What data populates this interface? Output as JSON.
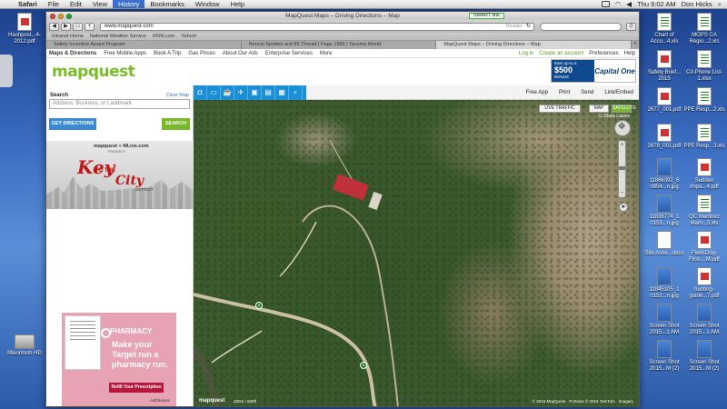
{
  "menubar": {
    "items": [
      "Safari",
      "File",
      "Edit",
      "View",
      "History",
      "Bookmarks",
      "Window",
      "Help"
    ],
    "clock": "Thu 9:02 AM",
    "user": "Don Hicks"
  },
  "window": {
    "title": "MapQuest Maps – Driving Directions – Map",
    "smart_link": "SMART link",
    "url": "www.mapquest.com",
    "reader": "Reader"
  },
  "bookmarks": [
    "Intranet Home",
    "National Weather Service",
    "MSN.com",
    "Yahoo!"
  ],
  "tabs": [
    "Safety Incentive Award Program",
    "Noncal Spotted and 85 Thread | Page 1965 | Tacoma World",
    "MapQuest Maps – Driving Directions – Map"
  ],
  "mq": {
    "topnav": [
      "Maps & Directions",
      "Free Mobile Apps",
      "Book A Trip",
      "Gas Prices",
      "About Our Ads",
      "Enterprise Services",
      "More"
    ],
    "login": "Log in",
    "create_account": "Create an account",
    "preferences": "Preferences",
    "help": "Help",
    "logo": "mapquest",
    "ad": {
      "line1": "Earn up to a",
      "amount": "$500",
      "bonus": "BONUS",
      "brand": "Capital One"
    },
    "search_label": "Search",
    "clear_map": "Clear Map",
    "search_placeholder": "Address, Business, or Landmark",
    "get_directions": "GET DIRECTIONS",
    "search_button": "SEARCH",
    "promo": {
      "brand": "mapquest + MLive.com",
      "presents": "PRESENTS",
      "key": "Key",
      "to_the": "TO THE",
      "city": "City",
      "detroit": "DETROIT"
    },
    "pharmacy": {
      "title": "PHARMACY",
      "body": "Make your Target run a pharmacy run.",
      "cta": "Refill Your Prescription"
    },
    "adchoices": "AdChoices",
    "map_toolbar_icons": [
      "mq-icon",
      "hotel-icon",
      "food-icon",
      "plane-icon",
      "car-icon",
      "cart-icon",
      "bus-icon",
      "search-icon"
    ],
    "map_actions": [
      "Free App",
      "Print",
      "Send",
      "Link/Embed"
    ],
    "live_traffic": "LIVE TRAFFIC",
    "map_types": [
      "MAP",
      "SATELLITE"
    ],
    "active_map_type": "SATELLITE",
    "show_labels": "Show Labels",
    "watermark": "mapquest",
    "scale": "200m / 600ft",
    "copyright": "© 2015 MapQuest · Portions © 2015 TomTom · Imagery"
  },
  "desktop_icons": [
    {
      "label": "Hashpost...4-2012.pdf",
      "type": "pdf"
    },
    {
      "label": "Chart of Acco...4.xls",
      "type": "xls"
    },
    {
      "label": "MOPS CA Regio...2.xls",
      "type": "xls"
    },
    {
      "label": "Safety Brief... 2015",
      "type": "pdf"
    },
    {
      "label": "CA Phone List-1.xlsx",
      "type": "xls"
    },
    {
      "label": "2677_001.pdf",
      "type": "pdf"
    },
    {
      "label": "PPE Resp...2.xls",
      "type": "xls"
    },
    {
      "label": "2678_001.pdf",
      "type": "pdf"
    },
    {
      "label": "PPE Resp...3.xls",
      "type": "xls"
    },
    {
      "label": "11866392_6 0854...n.jpg",
      "type": "img"
    },
    {
      "label": "Sudden Impa...4.pdf",
      "type": "pdf"
    },
    {
      "label": "11836774_1 0153...n.jpg",
      "type": "img"
    },
    {
      "label": "QC Martinez Marti...5.xls",
      "type": "xls"
    },
    {
      "label": "Site Asse...docx",
      "type": "doc"
    },
    {
      "label": "Field-Dog-First-...M.pdf",
      "type": "pdf"
    },
    {
      "label": "11845105_1 0152...n.jpg",
      "type": "img"
    },
    {
      "label": "hunting-guide...7.pdf",
      "type": "pdf"
    },
    {
      "label": "Screen Shot 2015...1 AM",
      "type": "img"
    },
    {
      "label": "Screen Shot 2015...1 AM",
      "type": "img"
    },
    {
      "label": "Screen Shot 2015...M (2)",
      "type": "img"
    },
    {
      "label": "Screen Shot 2015...M (2)",
      "type": "img"
    },
    {
      "label": "Macintosh HD",
      "type": "hd"
    }
  ]
}
